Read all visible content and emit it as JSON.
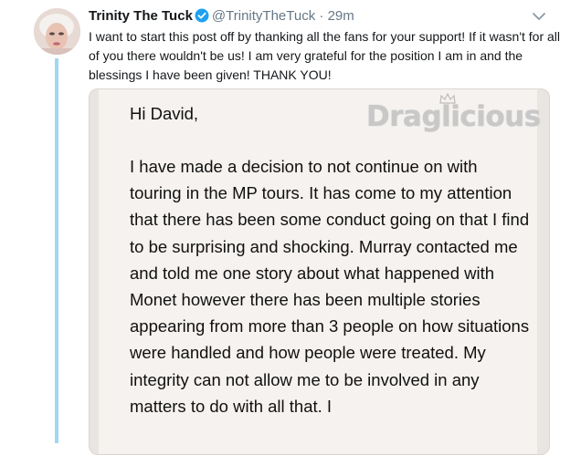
{
  "tweet": {
    "display_name": "Trinity The Tuck",
    "handle": "@TrinityTheTuck",
    "separator": "·",
    "time": "29m",
    "text": "I want to start this post off by thanking all the fans for your support! If it wasn't for all of you there wouldn't be us! I am very grateful for the position I am in and the blessings I have been given! THANK YOU!"
  },
  "image": {
    "greeting": "Hi David,",
    "body": "I have made a decision to not continue on with touring in the MP tours. It has come to my attention that there has been some conduct going on that I find to be surprising and shocking. Murray contacted me and told me one story about what happened with Monet however there has been multiple stories appearing from more than 3 people on how situations were handled and how people were treated. My integrity can not allow me to be involved in any matters to do with all that. I",
    "watermark": "Draglicious"
  },
  "icons": {
    "verified": "verified-badge-icon",
    "chevron": "chevron-down-icon",
    "avatar": "avatar"
  },
  "colors": {
    "verified_blue": "#1da1f2",
    "thread_line": "#9fd8f4",
    "muted_text": "#657786"
  }
}
